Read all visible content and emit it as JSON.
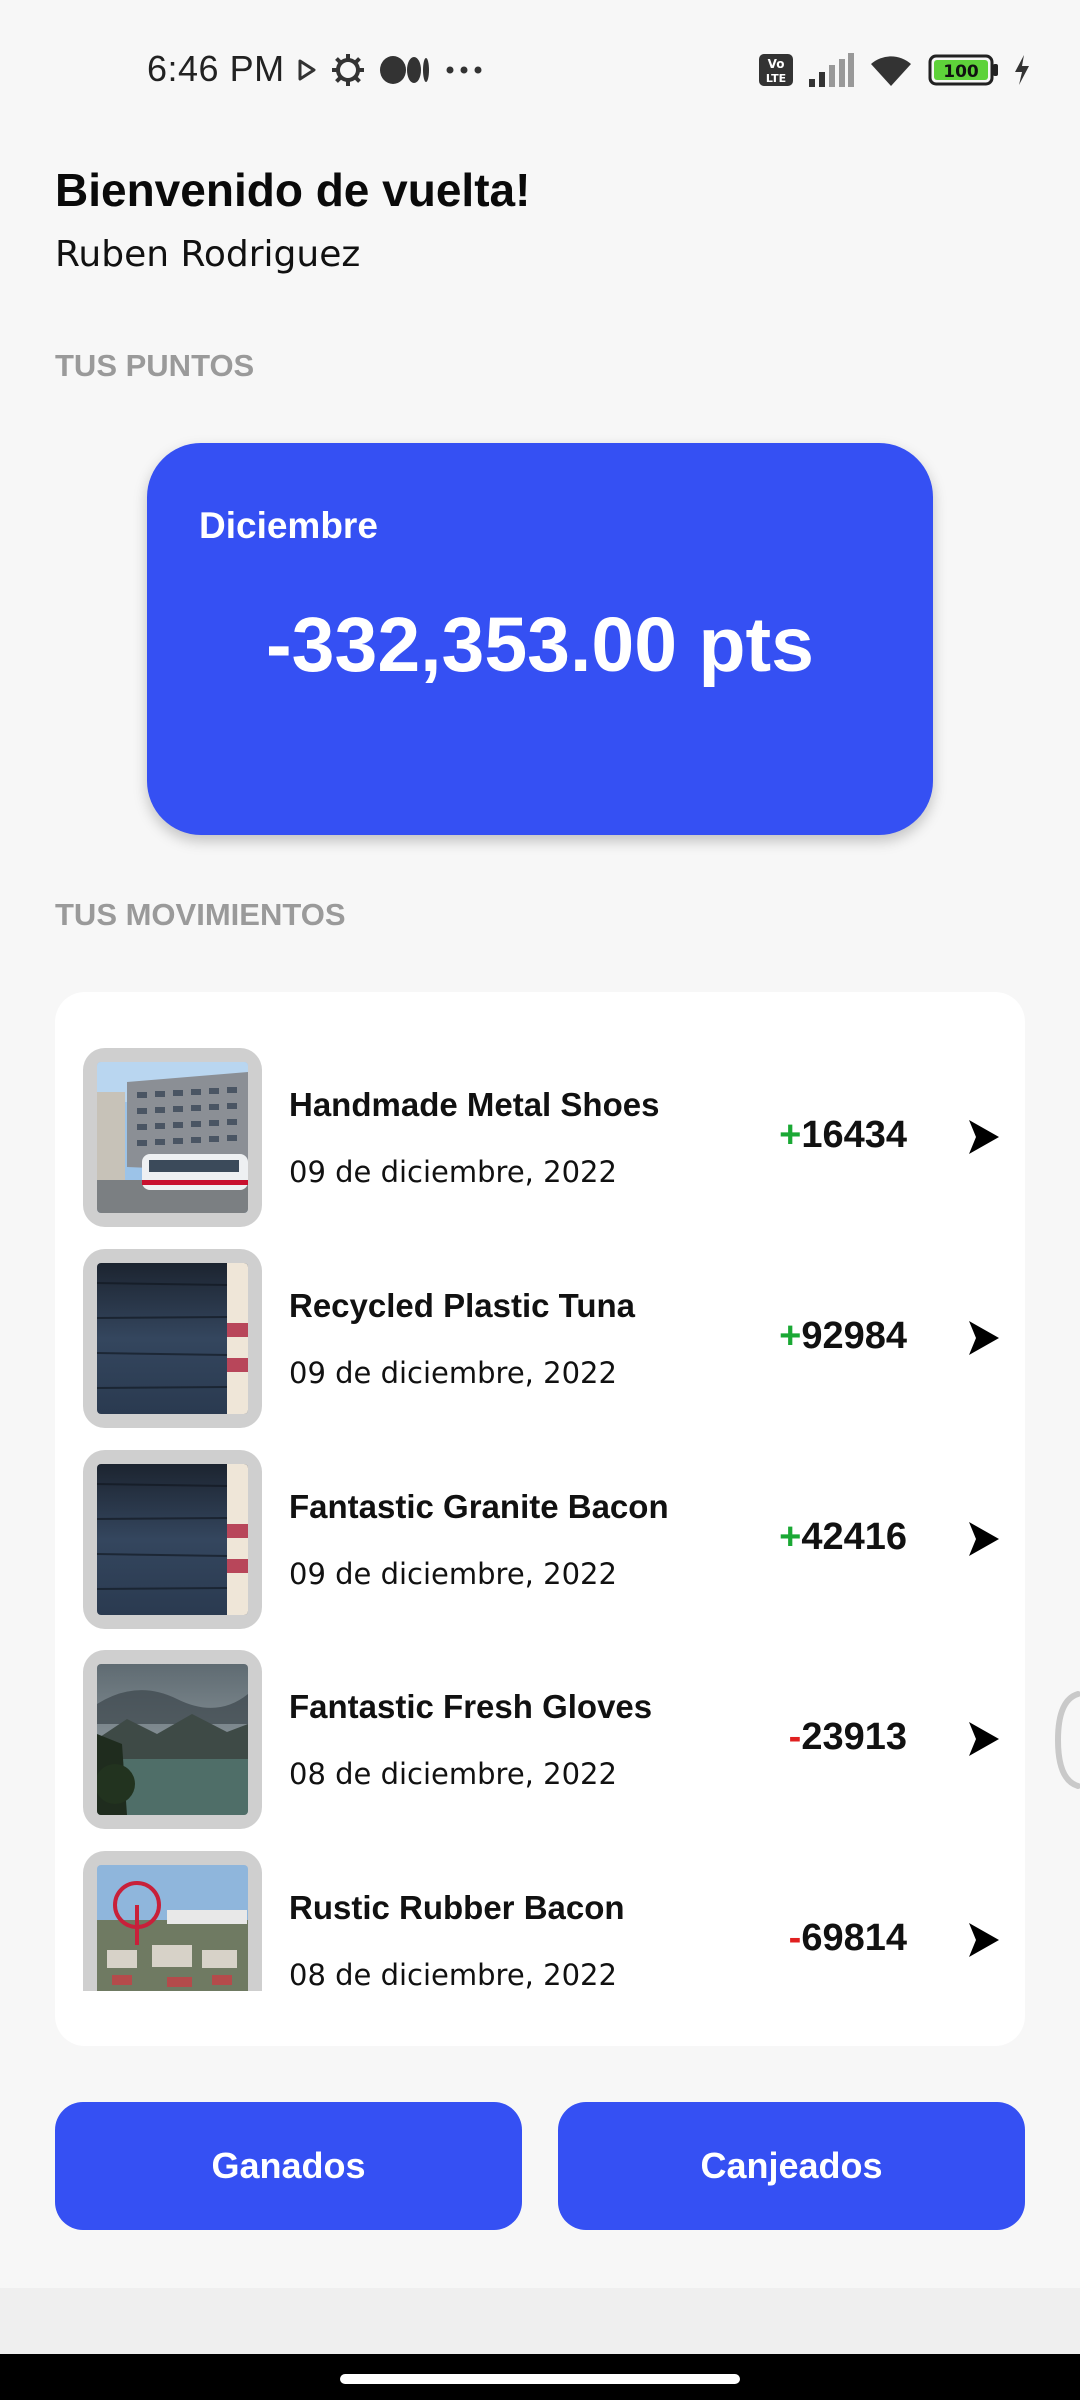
{
  "status_bar": {
    "time": "6:46 PM",
    "left_icons": [
      "play-store-icon",
      "settings-gear-icon",
      "medium-icon",
      "more-dots-icon"
    ],
    "right_icons": [
      "volte-icon",
      "signal-icon",
      "wifi-icon",
      "battery-icon",
      "charging-icon"
    ],
    "battery_level": "100"
  },
  "header": {
    "title": "Bienvenido de vuelta!",
    "user_name": "Ruben Rodriguez"
  },
  "points_section": {
    "label": "TUS PUNTOS",
    "month": "Diciembre",
    "value": "-332,353.00 pts",
    "card_color": "#3550f3"
  },
  "movements_section": {
    "label": "TUS MOVIMIENTOS",
    "items": [
      {
        "title": "Handmade Metal Shoes",
        "date": "09 de diciembre, 2022",
        "sign": "+",
        "amount": "16434",
        "thumb": "building-tram-photo"
      },
      {
        "title": "Recycled Plastic Tuna",
        "date": "09 de diciembre, 2022",
        "sign": "+",
        "amount": "92984",
        "thumb": "dark-blurred-photo"
      },
      {
        "title": "Fantastic Granite Bacon",
        "date": "09 de diciembre, 2022",
        "sign": "+",
        "amount": "42416",
        "thumb": "dark-blurred-photo"
      },
      {
        "title": "Fantastic Fresh Gloves",
        "date": "08 de diciembre, 2022",
        "sign": "-",
        "amount": "23913",
        "thumb": "lake-mountains-photo"
      },
      {
        "title": "Rustic Rubber Bacon",
        "date": "08 de diciembre, 2022",
        "sign": "-",
        "amount": "69814",
        "thumb": "amusement-park-photo"
      }
    ],
    "positive_color": "#1aa834",
    "negative_color": "#e02020"
  },
  "buttons": {
    "earned": "Ganados",
    "redeemed": "Canjeados"
  },
  "accent_color": "#3550f3"
}
